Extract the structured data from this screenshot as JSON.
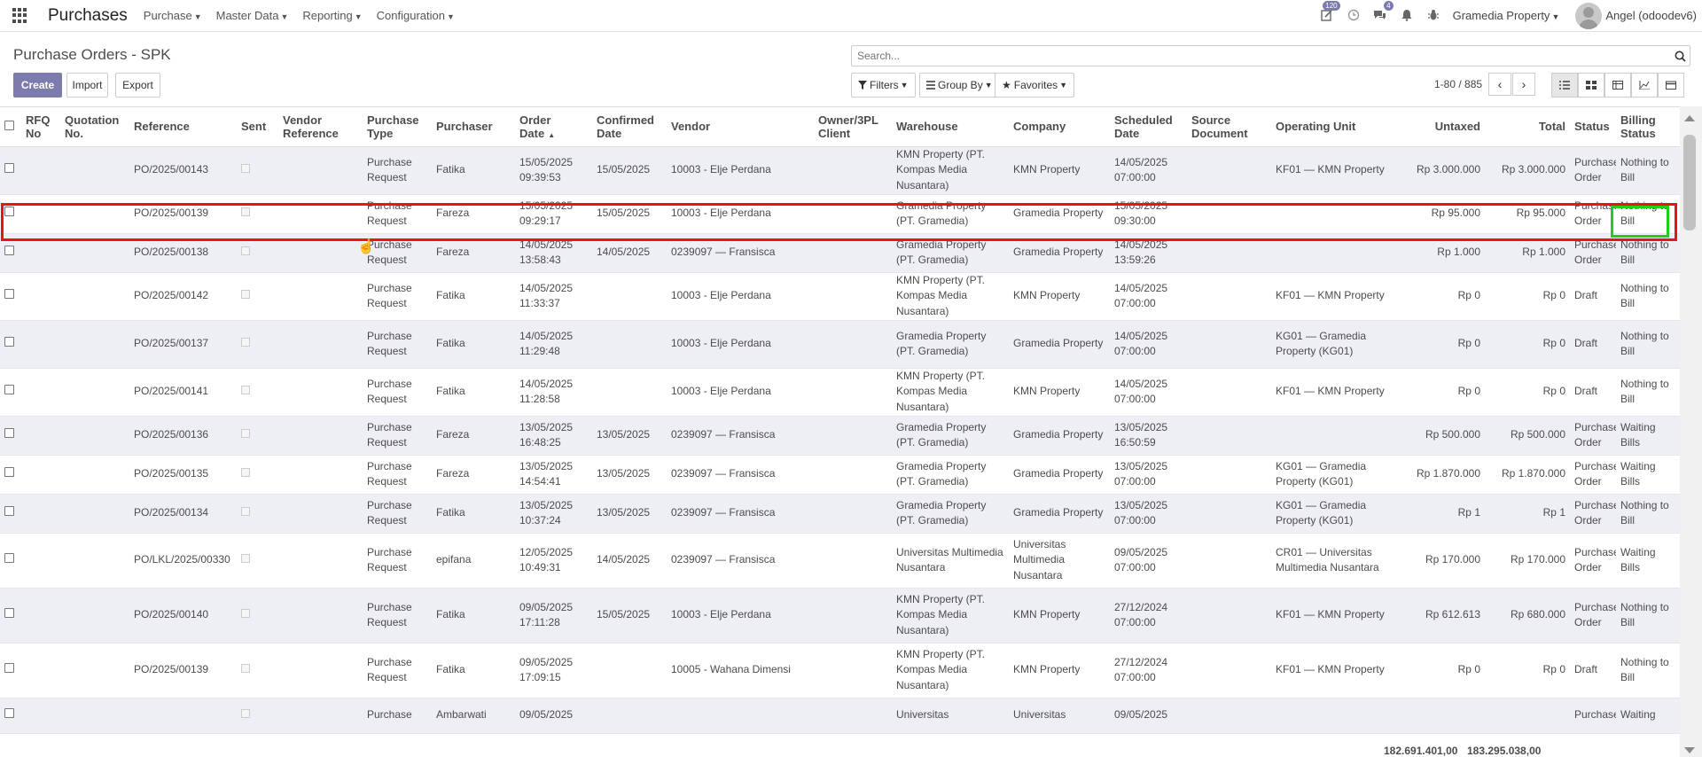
{
  "navbar": {
    "brand": "Purchases",
    "menu": [
      {
        "label": "Purchase"
      },
      {
        "label": "Master Data"
      },
      {
        "label": "Reporting"
      },
      {
        "label": "Configuration"
      }
    ],
    "activities_badge": "120",
    "messages_badge": "4",
    "company": "Gramedia Property",
    "user": "Angel (odoodev6)"
  },
  "control": {
    "breadcrumb": "Purchase Orders - SPK",
    "create": "Create",
    "import": "Import",
    "export": "Export",
    "search_placeholder": "Search...",
    "filters": "Filters",
    "group_by": "Group By",
    "favorites": "Favorites",
    "pager": "1-80 / 885"
  },
  "columns": [
    "RFQ No",
    "Quotation No.",
    "Reference",
    "Sent",
    "Vendor Reference",
    "Purchase Type",
    "Purchaser",
    "Order Date",
    "Confirmed Date",
    "Vendor",
    "Owner/3PL Client",
    "Warehouse",
    "Company",
    "Scheduled Date",
    "Source Document",
    "Operating Unit",
    "Untaxed",
    "Total",
    "Status",
    "Billing Status"
  ],
  "rows": [
    {
      "ref": "PO/2025/00143",
      "type": "Purchase Request",
      "purchaser": "Fatika",
      "order_date": "15/05/2025 09:39:53",
      "confirmed": "15/05/2025",
      "vendor": "10003 - Elje Perdana",
      "warehouse": "KMN Property (PT. Kompas Media Nusantara)",
      "company": "KMN Property",
      "scheduled": "14/05/2025 07:00:00",
      "unit": "KF01 — KMN Property",
      "untaxed": "Rp 3.000.000",
      "total": "Rp 3.000.000",
      "status": "Purchase Order",
      "billing": "Nothing to Bill"
    },
    {
      "ref": "PO/2025/00139",
      "type": "Purchase Request",
      "purchaser": "Fareza",
      "order_date": "15/05/2025 09:29:17",
      "confirmed": "15/05/2025",
      "vendor": "10003 - Elje Perdana",
      "warehouse": "Gramedia Property (PT. Gramedia)",
      "company": "Gramedia Property",
      "scheduled": "15/05/2025 09:30:00",
      "unit": "",
      "untaxed": "Rp 95.000",
      "total": "Rp 95.000",
      "status": "Purchase Order",
      "billing": "Nothing to Bill"
    },
    {
      "ref": "PO/2025/00138",
      "type": "Purchase Request",
      "purchaser": "Fareza",
      "order_date": "14/05/2025 13:58:43",
      "confirmed": "14/05/2025",
      "vendor": "0239097 — Fransisca",
      "warehouse": "Gramedia Property (PT. Gramedia)",
      "company": "Gramedia Property",
      "scheduled": "14/05/2025 13:59:26",
      "unit": "",
      "untaxed": "Rp 1.000",
      "total": "Rp 1.000",
      "status": "Purchase Order",
      "billing": "Nothing to Bill"
    },
    {
      "ref": "PO/2025/00142",
      "type": "Purchase Request",
      "purchaser": "Fatika",
      "order_date": "14/05/2025 11:33:37",
      "confirmed": "",
      "vendor": "10003 - Elje Perdana",
      "warehouse": "KMN Property (PT. Kompas Media Nusantara)",
      "company": "KMN Property",
      "scheduled": "14/05/2025 07:00:00",
      "unit": "KF01 — KMN Property",
      "untaxed": "Rp 0",
      "total": "Rp 0",
      "status": "Draft",
      "billing": "Nothing to Bill"
    },
    {
      "ref": "PO/2025/00137",
      "type": "Purchase Request",
      "purchaser": "Fatika",
      "order_date": "14/05/2025 11:29:48",
      "confirmed": "",
      "vendor": "10003 - Elje Perdana",
      "warehouse": "Gramedia Property (PT. Gramedia)",
      "company": "Gramedia Property",
      "scheduled": "14/05/2025 07:00:00",
      "unit": "KG01 — Gramedia Property (KG01)",
      "untaxed": "Rp 0",
      "total": "Rp 0",
      "status": "Draft",
      "billing": "Nothing to Bill"
    },
    {
      "ref": "PO/2025/00141",
      "type": "Purchase Request",
      "purchaser": "Fatika",
      "order_date": "14/05/2025 11:28:58",
      "confirmed": "",
      "vendor": "10003 - Elje Perdana",
      "warehouse": "KMN Property (PT. Kompas Media Nusantara)",
      "company": "KMN Property",
      "scheduled": "14/05/2025 07:00:00",
      "unit": "KF01 — KMN Property",
      "untaxed": "Rp 0",
      "total": "Rp 0",
      "status": "Draft",
      "billing": "Nothing to Bill"
    },
    {
      "ref": "PO/2025/00136",
      "type": "Purchase Request",
      "purchaser": "Fareza",
      "order_date": "13/05/2025 16:48:25",
      "confirmed": "13/05/2025",
      "vendor": "0239097 — Fransisca",
      "warehouse": "Gramedia Property (PT. Gramedia)",
      "company": "Gramedia Property",
      "scheduled": "13/05/2025 16:50:59",
      "unit": "",
      "untaxed": "Rp 500.000",
      "total": "Rp 500.000",
      "status": "Purchase Order",
      "billing": "Waiting Bills"
    },
    {
      "ref": "PO/2025/00135",
      "type": "Purchase Request",
      "purchaser": "Fareza",
      "order_date": "13/05/2025 14:54:41",
      "confirmed": "13/05/2025",
      "vendor": "0239097 — Fransisca",
      "warehouse": "Gramedia Property (PT. Gramedia)",
      "company": "Gramedia Property",
      "scheduled": "13/05/2025 07:00:00",
      "unit": "KG01 — Gramedia Property (KG01)",
      "untaxed": "Rp 1.870.000",
      "total": "Rp 1.870.000",
      "status": "Purchase Order",
      "billing": "Waiting Bills"
    },
    {
      "ref": "PO/2025/00134",
      "type": "Purchase Request",
      "purchaser": "Fatika",
      "order_date": "13/05/2025 10:37:24",
      "confirmed": "13/05/2025",
      "vendor": "0239097 — Fransisca",
      "warehouse": "Gramedia Property (PT. Gramedia)",
      "company": "Gramedia Property",
      "scheduled": "13/05/2025 07:00:00",
      "unit": "KG01 — Gramedia Property (KG01)",
      "untaxed": "Rp 1",
      "total": "Rp 1",
      "status": "Purchase Order",
      "billing": "Nothing to Bill"
    },
    {
      "ref": "PO/LKL/2025/00330",
      "type": "Purchase Request",
      "purchaser": "epifana",
      "order_date": "12/05/2025 10:49:31",
      "confirmed": "14/05/2025",
      "vendor": "0239097 — Fransisca",
      "warehouse": "Universitas Multimedia Nusantara",
      "company": "Universitas Multimedia Nusantara",
      "scheduled": "09/05/2025 07:00:00",
      "unit": "CR01 — Universitas Multimedia Nusantara",
      "untaxed": "Rp 170.000",
      "total": "Rp 170.000",
      "status": "Purchase Order",
      "billing": "Waiting Bills"
    },
    {
      "ref": "PO/2025/00140",
      "type": "Purchase Request",
      "purchaser": "Fatika",
      "order_date": "09/05/2025 17:11:28",
      "confirmed": "15/05/2025",
      "vendor": "10003 - Elje Perdana",
      "warehouse": "KMN Property (PT. Kompas Media Nusantara)",
      "company": "KMN Property",
      "scheduled": "27/12/2024 07:00:00",
      "unit": "KF01 — KMN Property",
      "untaxed": "Rp 612.613",
      "total": "Rp 680.000",
      "status": "Purchase Order",
      "billing": "Nothing to Bill"
    },
    {
      "ref": "PO/2025/00139",
      "type": "Purchase Request",
      "purchaser": "Fatika",
      "order_date": "09/05/2025 17:09:15",
      "confirmed": "",
      "vendor": "10005 - Wahana Dimensi",
      "warehouse": "KMN Property (PT. Kompas Media Nusantara)",
      "company": "KMN Property",
      "scheduled": "27/12/2024 07:00:00",
      "unit": "KF01 — KMN Property",
      "untaxed": "Rp 0",
      "total": "Rp 0",
      "status": "Draft",
      "billing": "Nothing to Bill"
    },
    {
      "ref": "",
      "type": "Purchase",
      "purchaser": "Ambarwati",
      "order_date": "09/05/2025",
      "confirmed": "",
      "vendor": "",
      "warehouse": "Universitas",
      "company": "Universitas",
      "scheduled": "09/05/2025",
      "unit": "",
      "untaxed": "",
      "total": "",
      "status": "Purchase",
      "billing": "Waiting"
    }
  ],
  "totals": {
    "untaxed": "182.691.401,00",
    "total": "183.295.038,00"
  }
}
